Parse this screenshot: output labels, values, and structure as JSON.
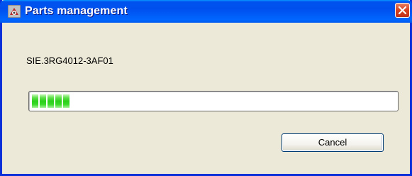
{
  "window": {
    "title": "Parts management",
    "title_icon": "parts-app-icon",
    "close_icon": "close-icon"
  },
  "message": "SIE.3RG4012-3AF01",
  "progress": {
    "fraction": 0.09,
    "blocks_visible": 5,
    "color": "#2bcf1b"
  },
  "buttons": {
    "cancel_label": "Cancel"
  },
  "colors": {
    "titlebar": "#0053ee",
    "close": "#d9411e",
    "dialog_bg": "#ece9d8"
  }
}
